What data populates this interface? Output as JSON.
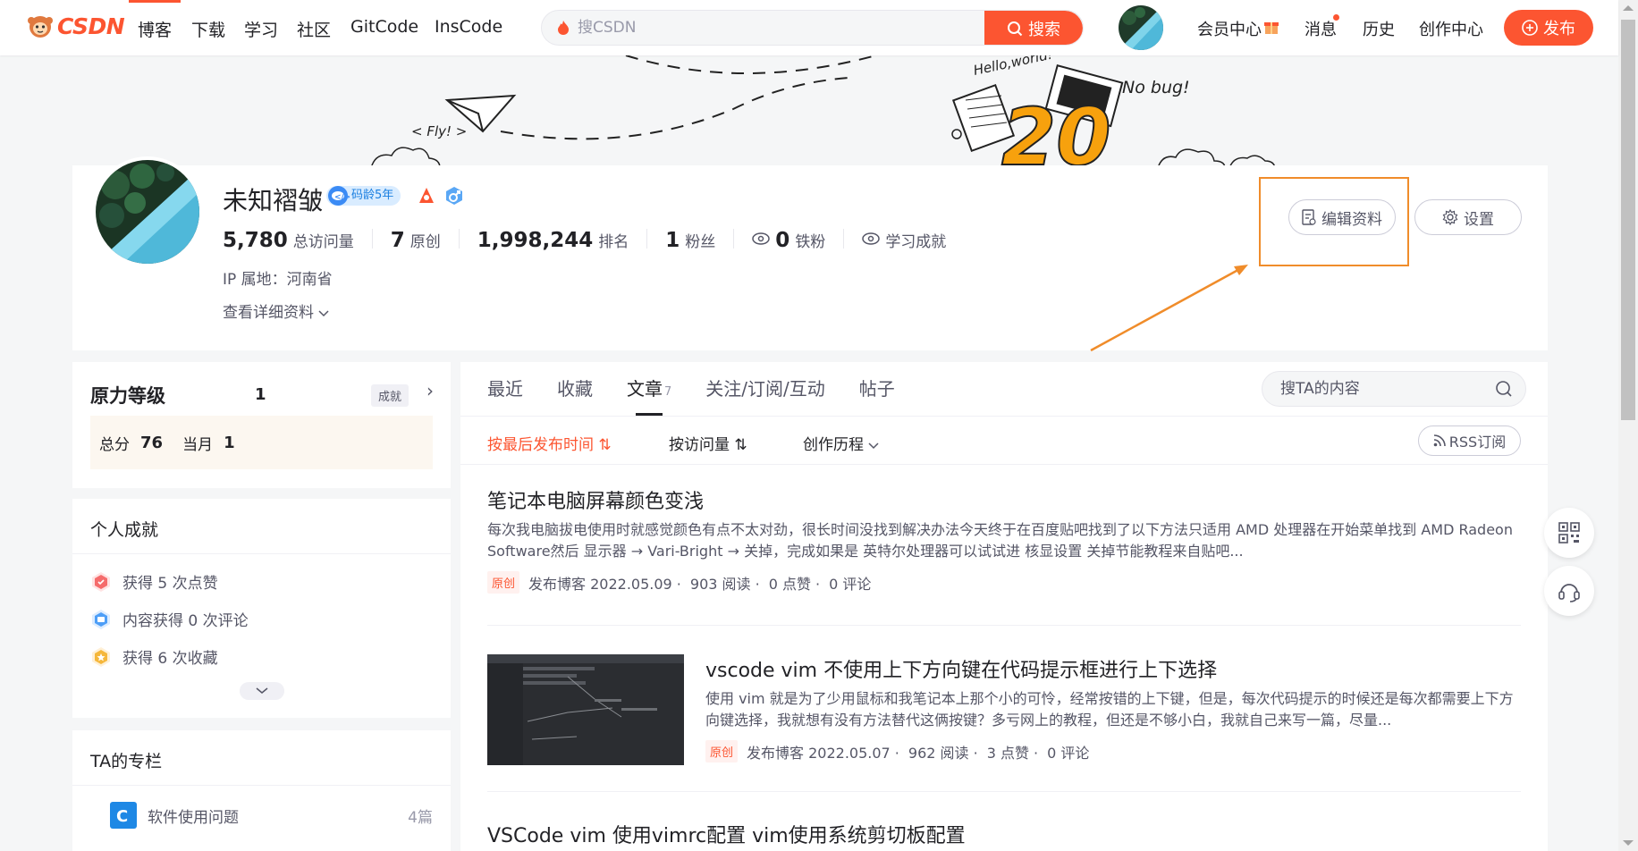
{
  "header": {
    "logo_text": "CSDN",
    "nav": [
      "博客",
      "下载",
      "学习",
      "社区",
      "GitCode",
      "InsCode"
    ],
    "search_placeholder": "搜CSDN",
    "search_button": "搜索",
    "right_links": {
      "vip": "会员中心",
      "messages": "消息",
      "history": "历史",
      "creator": "创作中心"
    },
    "publish_button": "发布",
    "brand_color": "#fc5531"
  },
  "banner": {
    "texts": [
      "< Fly! >",
      "Hello,world!",
      "No bug!",
      "20"
    ]
  },
  "profile": {
    "name": "未知褶皱",
    "age_badge": "码龄5年",
    "stats": [
      {
        "num": "5,780",
        "label": "总访问量"
      },
      {
        "num": "7",
        "label": "原创"
      },
      {
        "num": "1,998,244",
        "label": "排名"
      },
      {
        "num": "1",
        "label": "粉丝"
      },
      {
        "num": "0",
        "label": "铁粉"
      },
      {
        "num": "",
        "label": "学习成就"
      }
    ],
    "ip": "IP 属地：河南省",
    "detail_link": "查看详细资料",
    "edit_button": "编辑资料",
    "settings_button": "设置"
  },
  "level": {
    "title": "原力等级",
    "value": "1",
    "achievement_tag": "成就",
    "total_label": "总分",
    "total_value": "76",
    "month_label": "当月",
    "month_value": "1"
  },
  "achievements": {
    "title": "个人成就",
    "items": [
      "获得 5 次点赞",
      "内容获得 0 次评论",
      "获得 6 次收藏"
    ]
  },
  "columns": {
    "title": "TA的专栏",
    "items": [
      {
        "name": "软件使用问题",
        "count": "4篇"
      }
    ]
  },
  "tabs": {
    "items": [
      "最近",
      "收藏",
      "文章",
      "关注/订阅/互动",
      "帖子"
    ],
    "article_count": "7",
    "search_placeholder": "搜TA的内容"
  },
  "sort": {
    "items": [
      "按最后发布时间",
      "按访问量",
      "创作历程"
    ],
    "rss": "RSS订阅"
  },
  "articles": [
    {
      "title": "笔记本电脑屏幕颜色变浅",
      "desc": "每次我电脑拔电使用时就感觉颜色有点不太对劲，很长时间没找到解决办法今天终于在百度贴吧找到了以下方法只适用 AMD 处理器在开始菜单找到 AMD Radeon Software然后 显示器 → Vari-Bright → 关掉，完成如果是 英特尔处理器可以试试进 核显设置 关掉节能教程来自贴吧...",
      "tag": "原创",
      "date": "发布博客 2022.05.09 ·",
      "reads": "903 阅读 ·",
      "likes": "0 点赞 ·",
      "comments": "0 评论"
    },
    {
      "title": "vscode vim 不使用上下方向键在代码提示框进行上下选择",
      "desc": "使用 vim 就是为了少用鼠标和我笔记本上那个小的可怜，经常按错的上下键，但是，每次代码提示的时候还是每次都需要上下方向键选择，我就想有没有方法替代这俩按键？多亏网上的教程，但还是不够小白，我就自己来写一篇，尽量...",
      "tag": "原创",
      "date": "发布博客 2022.05.07 ·",
      "reads": "962 阅读 ·",
      "likes": "3 点赞 ·",
      "comments": "0 评论"
    },
    {
      "title": "VSCode vim 使用vimrc配置 vim使用系统剪切板配置"
    }
  ]
}
